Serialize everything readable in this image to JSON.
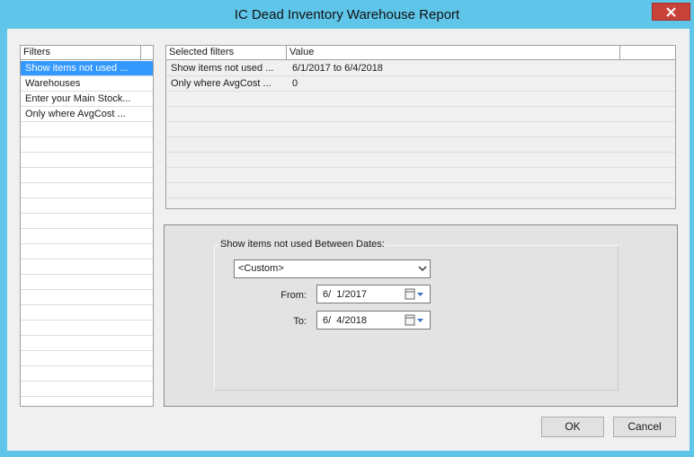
{
  "window": {
    "title": "IC Dead Inventory Warehouse Report"
  },
  "filters_list": {
    "header": "Filters",
    "items": [
      {
        "label": "Show items not used ...",
        "selected": true
      },
      {
        "label": "Warehouses",
        "selected": false
      },
      {
        "label": "Enter your Main Stock...",
        "selected": false
      },
      {
        "label": "Only where AvgCost ...",
        "selected": false
      }
    ]
  },
  "selected_grid": {
    "columns": [
      "Selected filters",
      "Value"
    ],
    "rows": [
      {
        "filter": "Show items not used ...",
        "value": "6/1/2017 to 6/4/2018"
      },
      {
        "filter": "Only where AvgCost ...",
        "value": "0"
      }
    ]
  },
  "date_panel": {
    "group_label": "Show items not used Between Dates:",
    "range_option": "<Custom>",
    "from_label": "From:",
    "from_value": "6/  1/2017",
    "to_label": "To:",
    "to_value": "6/  4/2018"
  },
  "buttons": {
    "ok": "OK",
    "cancel": "Cancel"
  },
  "colors": {
    "title_bar": "#5fc5e9",
    "close": "#c8423a",
    "selection": "#3399ff"
  },
  "icons": [
    "close-icon",
    "dropdown-arrow-icon",
    "calendar-icon"
  ]
}
